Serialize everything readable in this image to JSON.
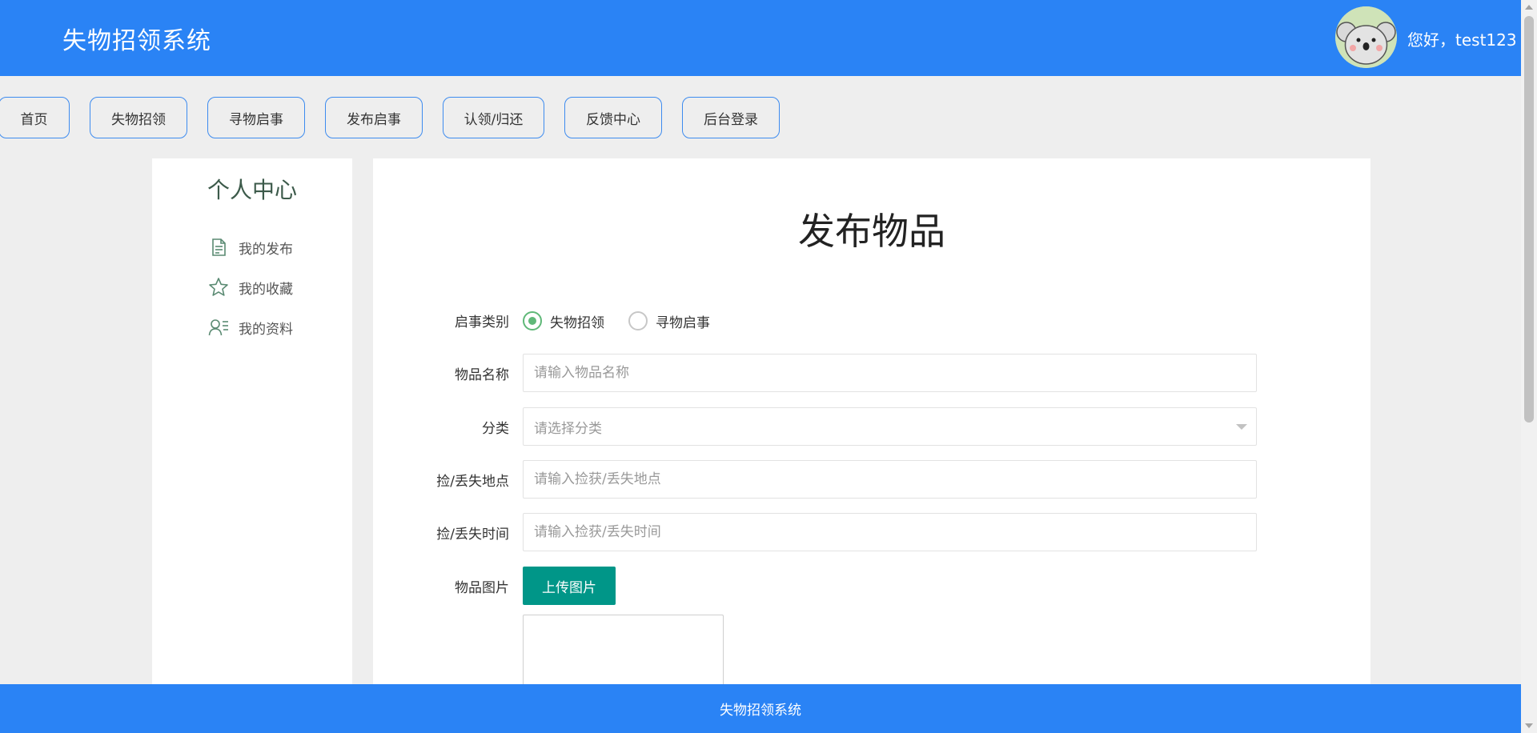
{
  "header": {
    "title": "失物招领系统",
    "greeting": "您好，test123",
    "brand_color": "#2a83f5"
  },
  "nav": {
    "items": [
      {
        "label": "首页"
      },
      {
        "label": "失物招领"
      },
      {
        "label": "寻物启事"
      },
      {
        "label": "发布启事"
      },
      {
        "label": "认领/归还"
      },
      {
        "label": "反馈中心"
      },
      {
        "label": "后台登录"
      }
    ]
  },
  "sidebar": {
    "title": "个人中心",
    "items": [
      {
        "label": "我的发布",
        "icon": "document-icon"
      },
      {
        "label": "我的收藏",
        "icon": "star-icon"
      },
      {
        "label": "我的资料",
        "icon": "profile-icon"
      }
    ]
  },
  "form": {
    "title": "发布物品",
    "type_label": "启事类别",
    "type_options": [
      {
        "label": "失物招领",
        "selected": true
      },
      {
        "label": "寻物启事",
        "selected": false
      }
    ],
    "name_label": "物品名称",
    "name_placeholder": "请输入物品名称",
    "category_label": "分类",
    "category_placeholder": "请选择分类",
    "place_label": "捡/丢失地点",
    "place_placeholder": "请输入捡获/丢失地点",
    "time_label": "捡/丢失时间",
    "time_placeholder": "请输入捡获/丢失时间",
    "image_label": "物品图片",
    "upload_label": "上传图片"
  },
  "footer": {
    "text": "失物招领系统"
  }
}
